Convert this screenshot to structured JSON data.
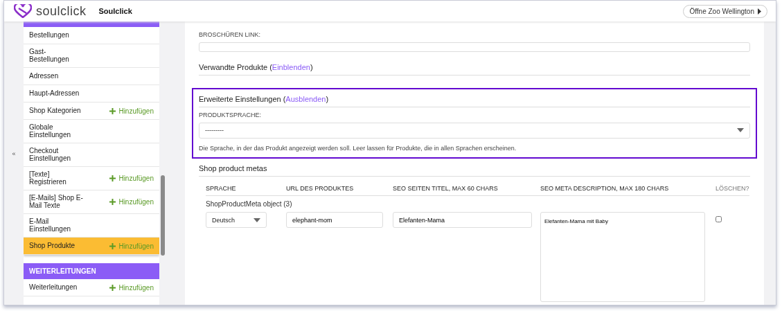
{
  "header": {
    "brand": "soulclick",
    "title": "Soulclick",
    "action": "Öffne Zoo Wellington"
  },
  "sidebar": {
    "collapse": "«",
    "sections": [
      {
        "items": [
          {
            "label": "Bestellungen",
            "selected": false
          },
          {
            "label": "Gast-\nBestellungen",
            "selected": false
          },
          {
            "label": "Adressen",
            "selected": false
          },
          {
            "label": "Haupt-Adressen",
            "selected": false
          },
          {
            "label": "Shop Kategorien",
            "add": "Hinzufügen",
            "selected": false
          },
          {
            "label": "Globale\nEinstellungen",
            "selected": false
          },
          {
            "label": "Checkout\nEinstellungen",
            "selected": false
          },
          {
            "label": "[Texte]\nRegistrieren",
            "add": "Hinzufügen",
            "selected": false
          },
          {
            "label": "[E-Mails] Shop E-\nMail Texte",
            "add": "Hinzufügen",
            "selected": false
          },
          {
            "label": "E-Mail\nEinstellungen",
            "selected": false
          },
          {
            "label": "Shop Produkte",
            "add": "Hinzufügen",
            "selected": true
          }
        ]
      },
      {
        "title": "WEITERLEITUNGEN",
        "items": [
          {
            "label": "Weiterleitungen",
            "add": "Hinzufügen",
            "selected": false
          }
        ]
      }
    ]
  },
  "form": {
    "brochure_label": "BROSCHÜREN LINK:",
    "related": {
      "title": "Verwandte Produkte",
      "open": "(",
      "toggle": "Einblenden",
      "close": ")"
    },
    "advanced": {
      "title": "Erweiterte Einstellungen",
      "open": "(",
      "toggle": "Ausblenden",
      "close": ")",
      "expanded": true,
      "language_label": "PRODUKTSPRACHE:",
      "language_value": "---------",
      "help": "Die Sprache, in der das Produkt angezeigt werden soll. Leer lassen für Produkte, die in allen Sprachen erscheinen."
    },
    "metas": {
      "title": "Shop product metas",
      "columns": [
        "SPRACHE",
        "URL DES PRODUKTES",
        "SEO SEITEN TITEL, MAX 60 CHARS",
        "SEO META DESCRIPTION, MAX 180 CHARS",
        "LÖSCHEN?"
      ],
      "rows": [
        {
          "object": "ShopProductMeta object (3)",
          "language": "Deutsch",
          "url": "elephant-mom",
          "seo_title": "Elefanten-Mama",
          "seo_description": "Elefanten-Mama mit Baby",
          "delete": false
        }
      ]
    }
  }
}
